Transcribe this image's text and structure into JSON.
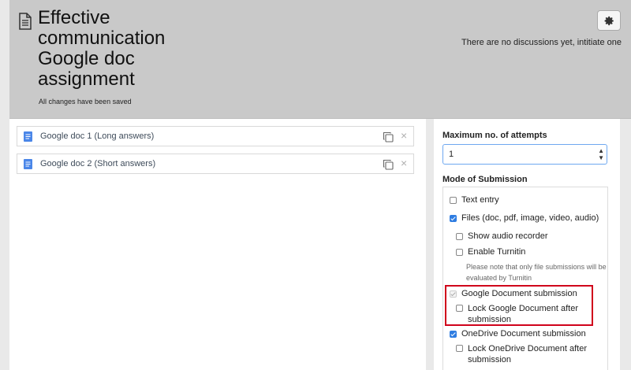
{
  "header": {
    "title": "Effective\ncommunication\nGoogle doc\nassignment",
    "save_status": "All changes have been saved",
    "discussions_text": "There are no discussions yet, intitiate one"
  },
  "documents": [
    {
      "label": "Google doc 1 (Long answers)",
      "icon": "google-doc-icon"
    },
    {
      "label": "Google doc 2 (Short answers)",
      "icon": "google-doc-icon"
    }
  ],
  "settings": {
    "max_attempts_label": "Maximum no. of attempts",
    "max_attempts_value": "1",
    "mode_label": "Mode of Submission",
    "options": {
      "text_entry": {
        "label": "Text entry",
        "checked": false
      },
      "files": {
        "label": "Files (doc, pdf, image, video, audio)",
        "checked": true
      },
      "audio_recorder": {
        "label": "Show audio recorder",
        "checked": false
      },
      "turnitin": {
        "label": "Enable Turnitin",
        "checked": false
      },
      "turnitin_note": "Please note that only file submissions will be evaluated by Turnitin",
      "google_doc": {
        "label": "Google Document submission",
        "checked": true,
        "disabled": true
      },
      "lock_google": {
        "label": "Lock Google Document after submission",
        "checked": false
      },
      "onedrive": {
        "label": "OneDrive Document submission",
        "checked": true
      },
      "lock_onedrive": {
        "label": "Lock OneDrive Document after submission",
        "checked": false
      }
    }
  },
  "colors": {
    "accent": "#2f7de1",
    "highlight": "#d0021b",
    "header_bg": "#c9c9c9",
    "doc_blue": "#4a86e8"
  }
}
